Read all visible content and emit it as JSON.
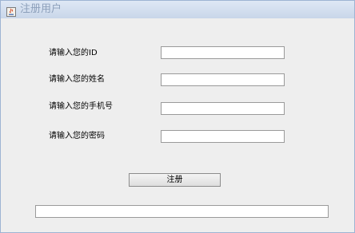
{
  "window": {
    "title": "注册用户",
    "icon": "java-app-icon"
  },
  "form": {
    "fields": [
      {
        "label": "请输入您的ID",
        "value": ""
      },
      {
        "label": "请输入您的姓名",
        "value": ""
      },
      {
        "label": "请输入您的手机号",
        "value": ""
      },
      {
        "label": "请输入您的密码",
        "value": ""
      }
    ],
    "submit_label": "注册",
    "status_value": ""
  }
}
